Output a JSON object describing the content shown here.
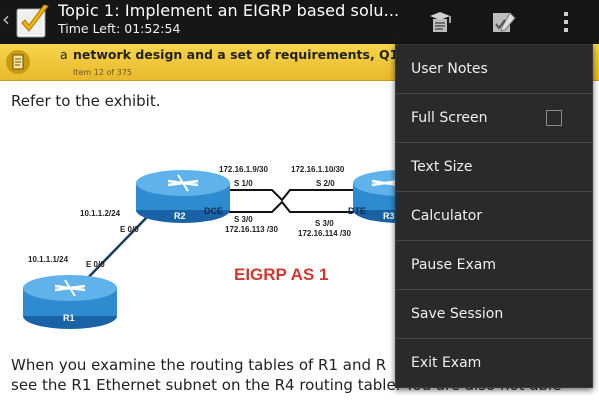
{
  "header": {
    "back_icon": "chevron-left-icon",
    "logo_icon": "checkbox-logo-icon",
    "title": "Topic 1:  Implement an EIGRP based solu...",
    "time_left": "Time Left: 01:52:54",
    "actions": [
      {
        "icon": "notes-cap-icon"
      },
      {
        "icon": "edit-check-icon"
      },
      {
        "icon": "overflow-menu-icon"
      }
    ]
  },
  "banner": {
    "prefix": "a",
    "question": "network design and a set of requirements, Q12",
    "item": "Item 12 of 375",
    "icon": "document-icon",
    "colors": {
      "background": "#f1cb3f",
      "text": "#222222"
    }
  },
  "content": {
    "refer": "Refer to the exhibit.",
    "question_line1": "When you examine the routing tables of R1 and R",
    "question_line2": "see the R1 Ethernet subnet on the R4 routing table. You are also not able"
  },
  "exhibit": {
    "caption": "EIGRP AS 1",
    "labels": {
      "r1": "R1",
      "r2": "R2",
      "r3": "R3",
      "dce": "DCE",
      "dte": "DTE",
      "e00_r1": "E 0/0",
      "e00_r2": "E 0/0",
      "net_r1": "10.1.1.1/24",
      "net_r2": "10.1.1.2/24",
      "s10_ip": "172.16.1.9/30",
      "s10": "S 1/0",
      "s20_ip": "172.16.1.10/30",
      "s20": "S 2/0",
      "s30_r2": "S 3/0",
      "s30_r2_ip": "172.16.113 /30",
      "s30_r3": "S 3/0",
      "s30_r3_ip": "172.16.114 /30"
    }
  },
  "menu": {
    "items": [
      {
        "label": "User Notes"
      },
      {
        "label": "Full Screen",
        "checkbox": false
      },
      {
        "label": "Text Size"
      },
      {
        "label": "Calculator"
      },
      {
        "label": "Pause Exam"
      },
      {
        "label": "Save Session"
      },
      {
        "label": "Exit Exam"
      }
    ],
    "colors": {
      "background": "#2a2a2a",
      "divider": "#474747"
    }
  }
}
